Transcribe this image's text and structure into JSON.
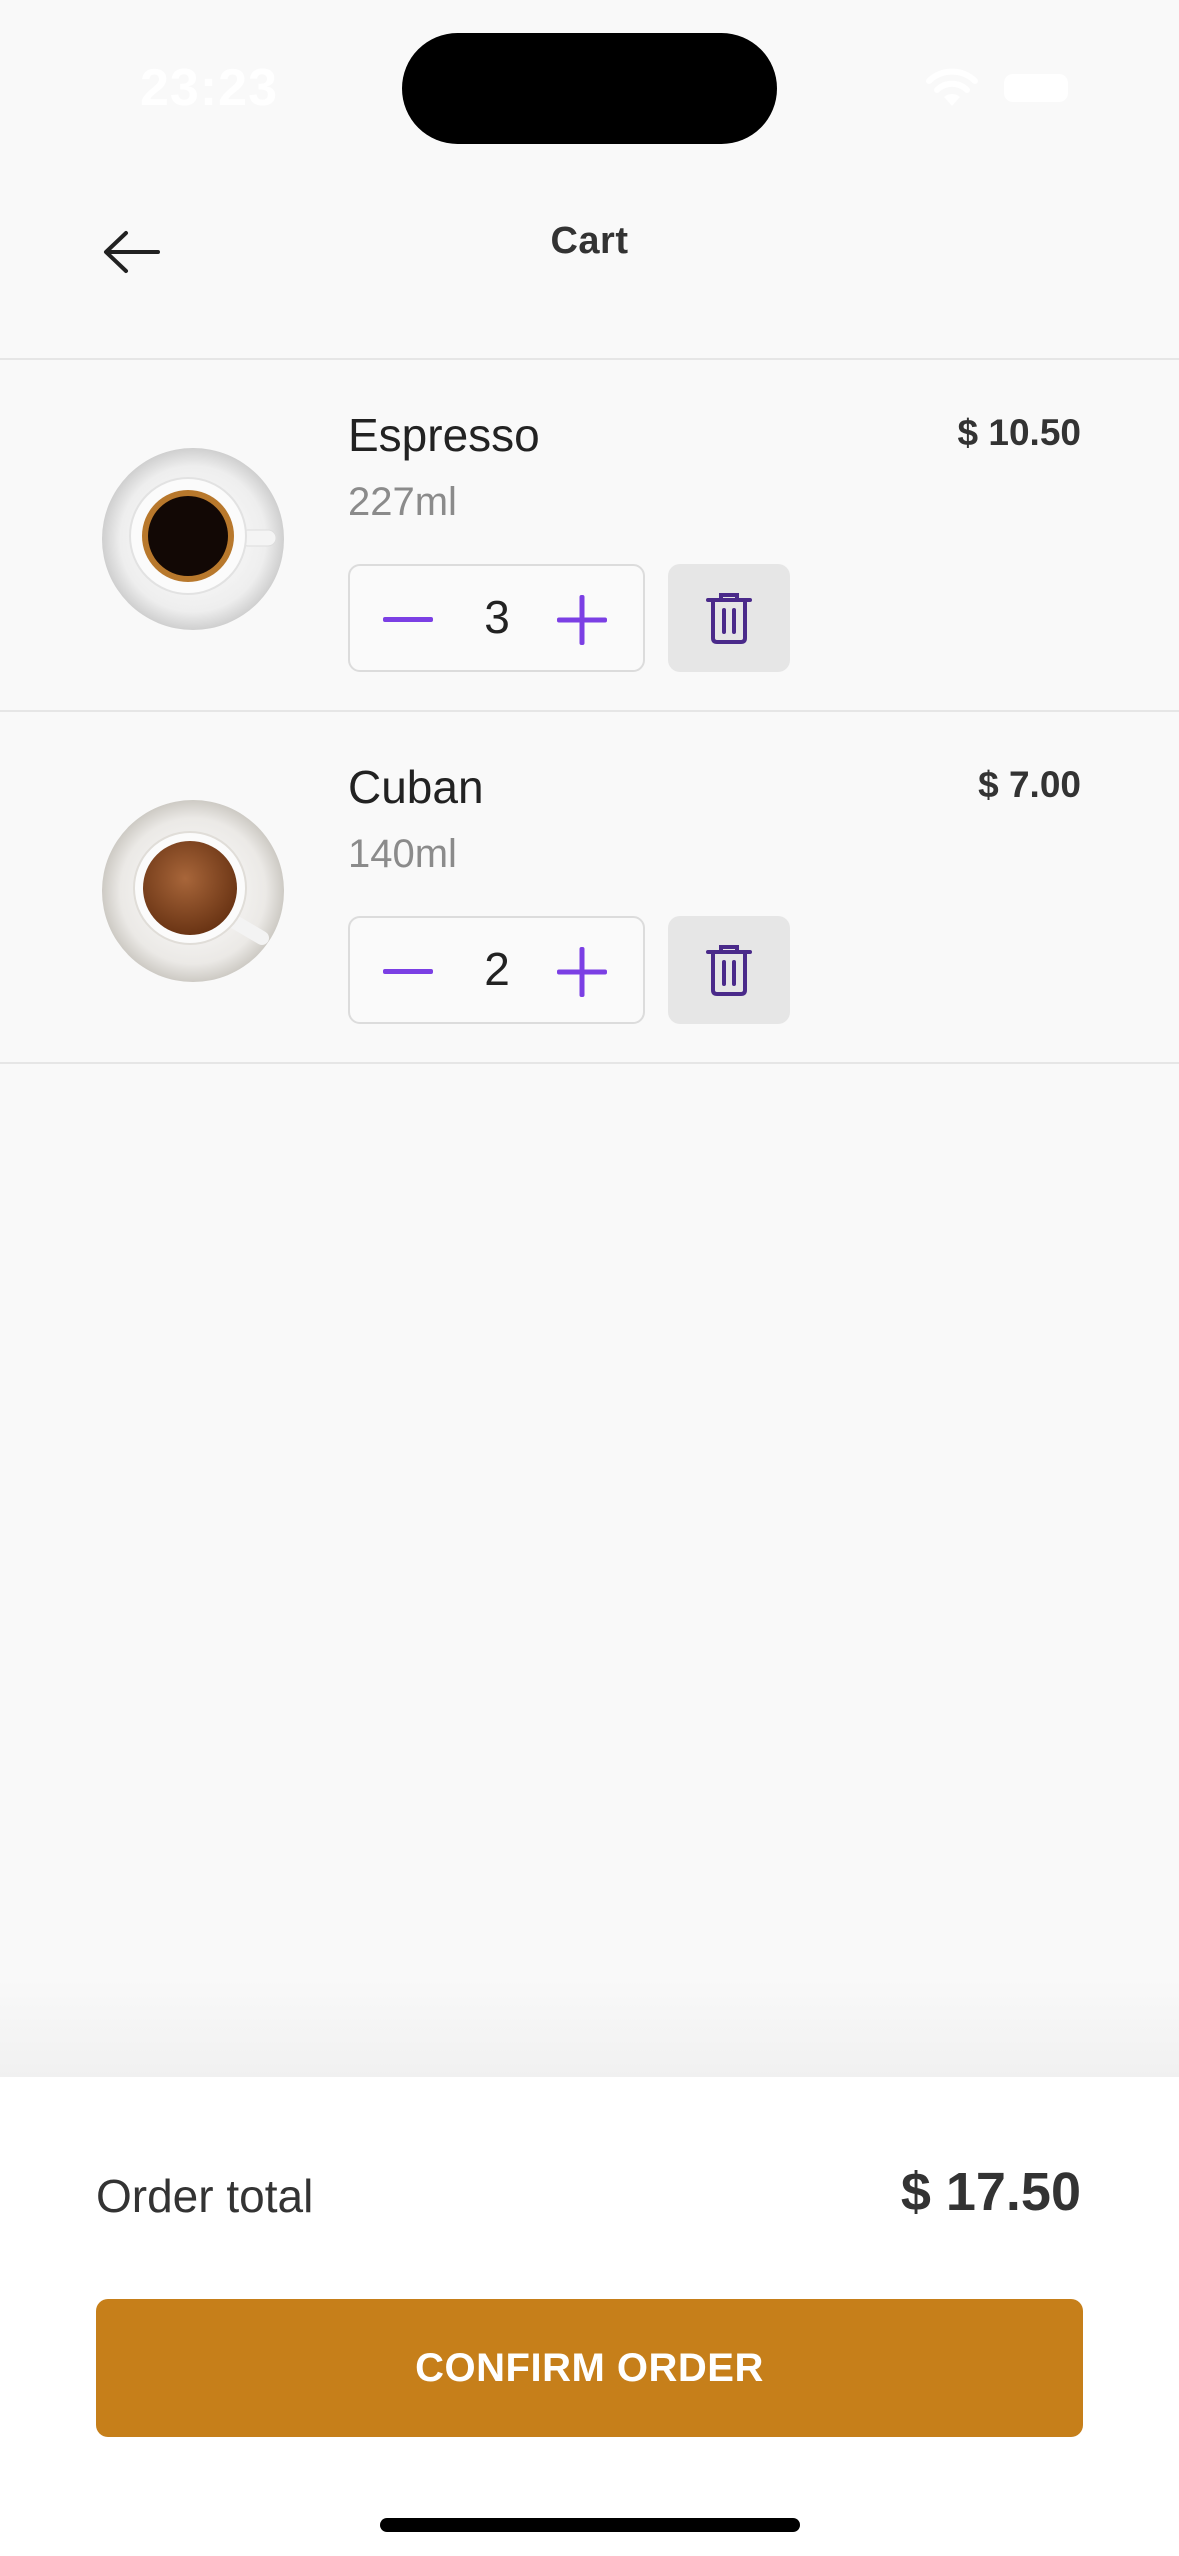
{
  "status_bar": {
    "time": "23:23"
  },
  "header": {
    "title": "Cart",
    "back_icon": "arrow-left-icon"
  },
  "cart": {
    "items": [
      {
        "name": "Espresso",
        "volume": "227ml",
        "price": "$ 10.50",
        "quantity": "3",
        "image": "espresso-cup-image"
      },
      {
        "name": "Cuban",
        "volume": "140ml",
        "price": "$ 7.00",
        "quantity": "2",
        "image": "cuban-coffee-cup-image"
      }
    ]
  },
  "footer": {
    "order_total_label": "Order total",
    "order_total_value": "$ 17.50",
    "confirm_label": "CONFIRM ORDER"
  },
  "colors": {
    "accent_purple": "#7b3fe4",
    "confirm_button": "#c67f1a",
    "trash_icon": "#4a2a8a",
    "background": "#f9f9f9"
  }
}
